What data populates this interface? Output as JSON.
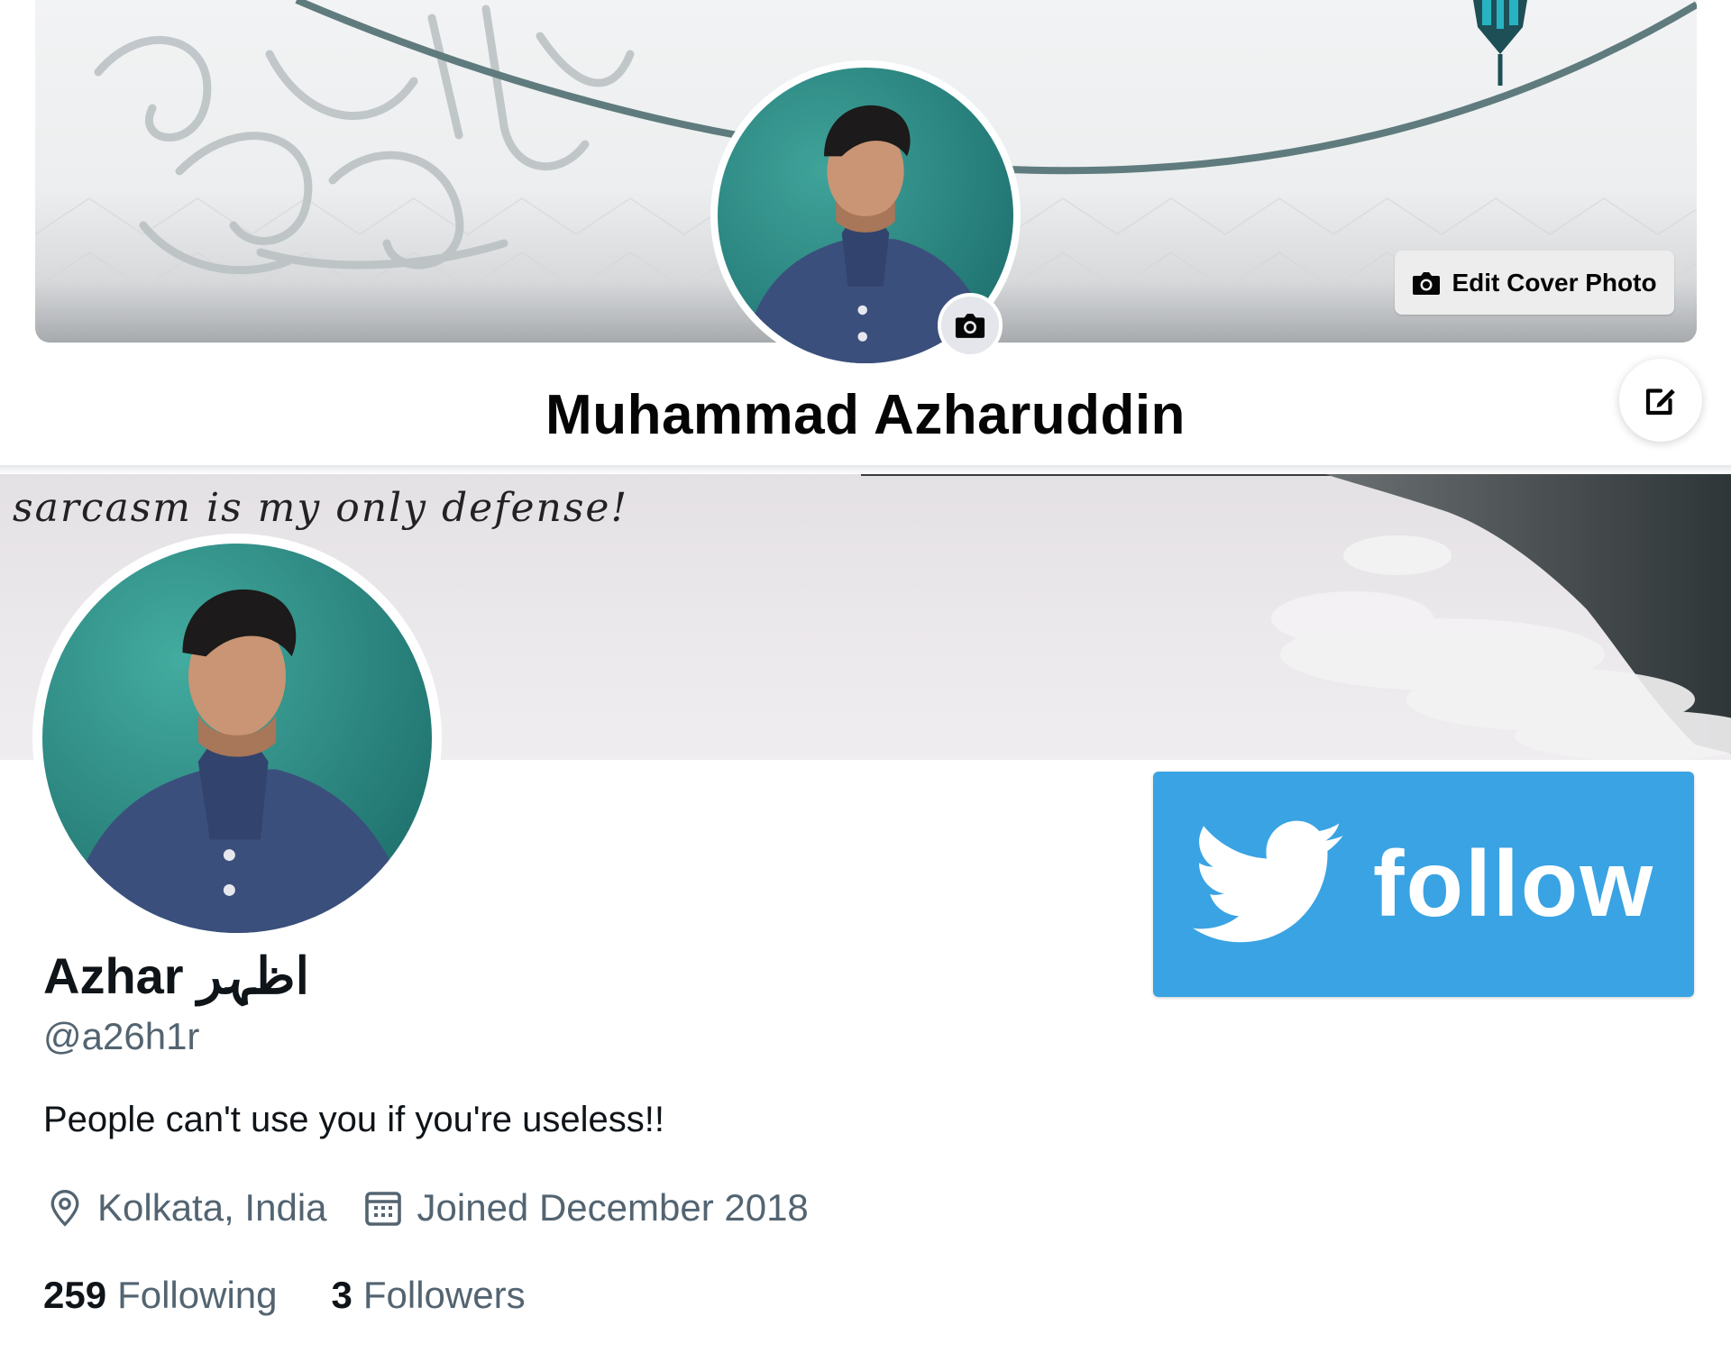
{
  "facebook": {
    "profile_name": "Muhammad Azharuddin",
    "edit_cover_label": "Edit Cover Photo",
    "icons": {
      "camera": "camera-icon",
      "edit": "pencil-square-icon"
    }
  },
  "twitter": {
    "banner_text": "sarcasm is my only defense!",
    "display_name": "Azhar اظہر",
    "handle": "@a26h1r",
    "bio": "People can't use you if you're useless!!",
    "location": "Kolkata, India",
    "joined": "Joined December 2018",
    "following_count": "259",
    "following_label": "Following",
    "followers_count": "3",
    "followers_label": "Followers",
    "follow_button_label": "follow",
    "colors": {
      "follow_blue": "#3aa3e3",
      "secondary_text": "#536471"
    },
    "icons": {
      "location": "location-pin-icon",
      "calendar": "calendar-icon",
      "bird": "twitter-bird-icon"
    }
  }
}
